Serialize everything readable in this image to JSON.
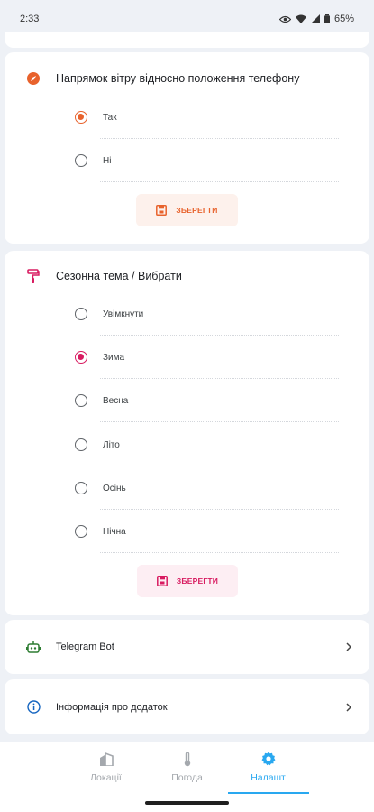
{
  "status_bar": {
    "time": "2:33",
    "battery": "65%"
  },
  "wind_card": {
    "title": "Напрямок вітру відносно положення телефону",
    "options": [
      {
        "label": "Так",
        "selected": true
      },
      {
        "label": "Ні",
        "selected": false
      }
    ],
    "save_label": "ЗБЕРЕГТИ",
    "accent": "#e8622c"
  },
  "theme_card": {
    "title": "Сезонна тема / Вибрати",
    "options": [
      {
        "label": "Увімкнути",
        "selected": false
      },
      {
        "label": "Зима",
        "selected": true
      },
      {
        "label": "Весна",
        "selected": false
      },
      {
        "label": "Літо",
        "selected": false
      },
      {
        "label": "Осінь",
        "selected": false
      },
      {
        "label": "Нічна",
        "selected": false
      }
    ],
    "save_label": "ЗБЕРЕГТИ",
    "accent": "#d81b60"
  },
  "links": {
    "telegram": "Telegram Bot",
    "info": "Інформація про додаток"
  },
  "bottom_nav": {
    "items": [
      {
        "label": "Локації",
        "icon": "buildings-icon",
        "active": false
      },
      {
        "label": "Погода",
        "icon": "thermometer-icon",
        "active": false
      },
      {
        "label": "Налашт",
        "icon": "gear-icon",
        "active": true
      }
    ],
    "active_color": "#29a8f0",
    "inactive_color": "#a4a8ad"
  }
}
